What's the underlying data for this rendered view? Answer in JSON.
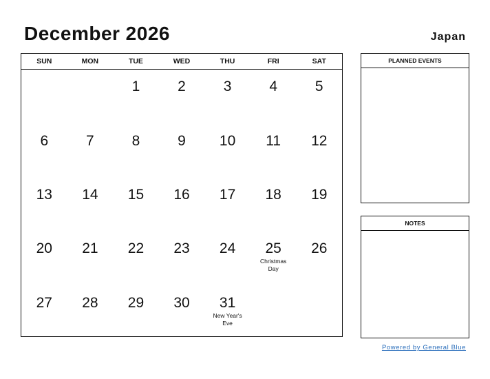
{
  "header": {
    "title": "December 2026",
    "country": "Japan"
  },
  "calendar": {
    "weekdays": [
      "SUN",
      "MON",
      "TUE",
      "WED",
      "THU",
      "FRI",
      "SAT"
    ],
    "weeks": [
      [
        {
          "day": ""
        },
        {
          "day": ""
        },
        {
          "day": "1"
        },
        {
          "day": "2"
        },
        {
          "day": "3"
        },
        {
          "day": "4"
        },
        {
          "day": "5"
        }
      ],
      [
        {
          "day": "6"
        },
        {
          "day": "7"
        },
        {
          "day": "8"
        },
        {
          "day": "9"
        },
        {
          "day": "10"
        },
        {
          "day": "11"
        },
        {
          "day": "12"
        }
      ],
      [
        {
          "day": "13"
        },
        {
          "day": "14"
        },
        {
          "day": "15"
        },
        {
          "day": "16"
        },
        {
          "day": "17"
        },
        {
          "day": "18"
        },
        {
          "day": "19"
        }
      ],
      [
        {
          "day": "20"
        },
        {
          "day": "21"
        },
        {
          "day": "22"
        },
        {
          "day": "23"
        },
        {
          "day": "24"
        },
        {
          "day": "25",
          "event": "Christmas Day"
        },
        {
          "day": "26"
        }
      ],
      [
        {
          "day": "27"
        },
        {
          "day": "28"
        },
        {
          "day": "29"
        },
        {
          "day": "30"
        },
        {
          "day": "31",
          "event": "New Year's Eve"
        },
        {
          "day": ""
        },
        {
          "day": ""
        }
      ]
    ]
  },
  "panels": {
    "planned_events": "PLANNED EVENTS",
    "notes": "NOTES"
  },
  "footer": {
    "link": "Powered by General Blue"
  }
}
